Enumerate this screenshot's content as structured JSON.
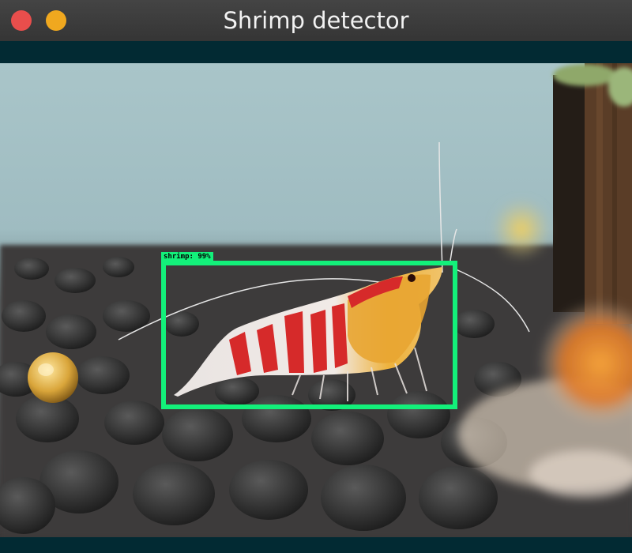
{
  "window": {
    "title": "Shrimp detector"
  },
  "detection": {
    "label": "shrimp: 99%",
    "box_color": "#13f07a"
  },
  "colors": {
    "titlebar": "#3c3c3c",
    "close_button": "#e94e4c",
    "minimize_button": "#f0a81f",
    "background_band": "#022a33"
  },
  "icons": {
    "close": "close-dot-icon",
    "minimize": "minimize-dot-icon"
  }
}
